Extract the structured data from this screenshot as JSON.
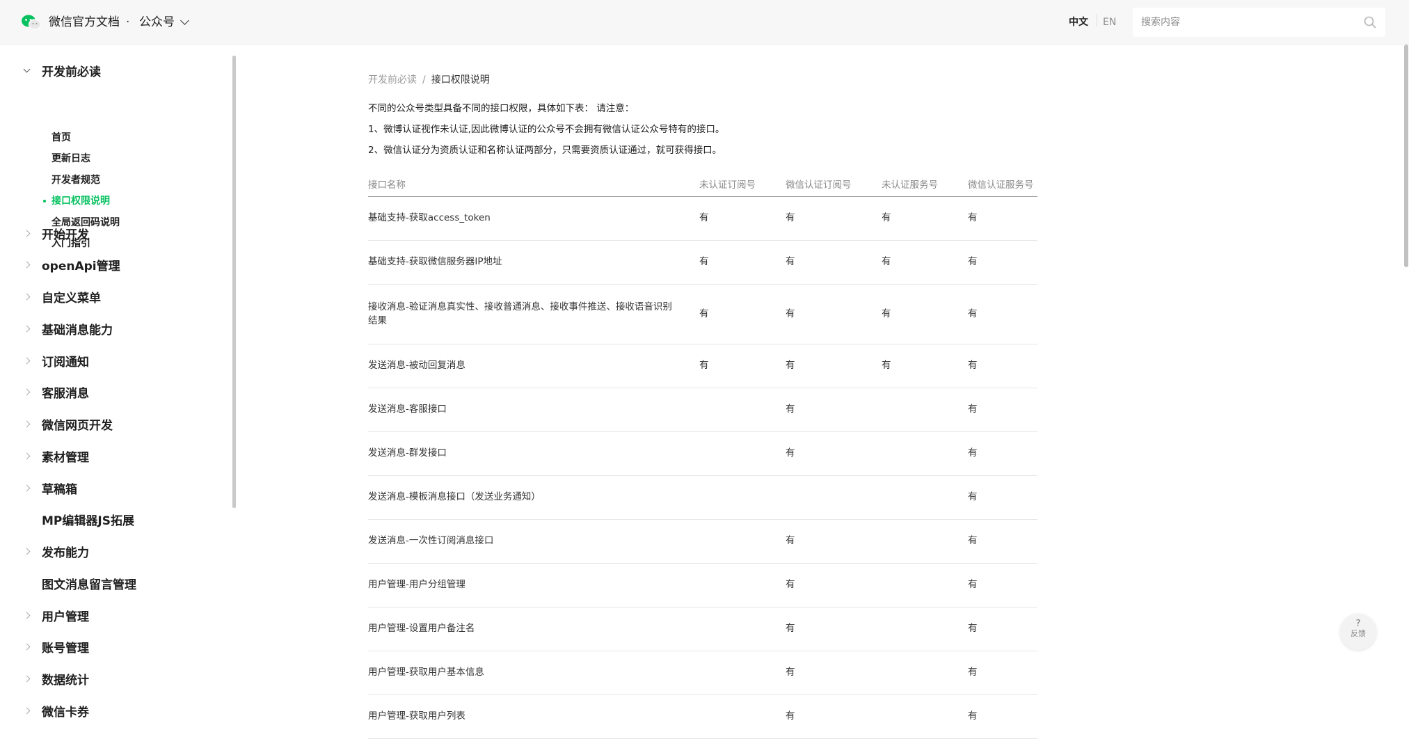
{
  "header": {
    "brand": "微信官方文档",
    "separator": "·",
    "product": "公众号",
    "lang_zh": "中文",
    "lang_en": "EN",
    "search_placeholder": "搜索内容"
  },
  "sidebar": {
    "group_open": "开发前必读",
    "sub_items": [
      {
        "label": "首页",
        "active": false
      },
      {
        "label": "更新日志",
        "active": false
      },
      {
        "label": "开发者规范",
        "active": false
      },
      {
        "label": "接口权限说明",
        "active": true
      },
      {
        "label": "全局返回码说明",
        "active": false
      },
      {
        "label": "入门指引",
        "active": false
      }
    ],
    "sections": [
      {
        "label": "开始开发",
        "arrow": true
      },
      {
        "label": "openApi管理",
        "arrow": true
      },
      {
        "label": "自定义菜单",
        "arrow": true
      },
      {
        "label": "基础消息能力",
        "arrow": true
      },
      {
        "label": "订阅通知",
        "arrow": true
      },
      {
        "label": "客服消息",
        "arrow": true
      },
      {
        "label": "微信网页开发",
        "arrow": true
      },
      {
        "label": "素材管理",
        "arrow": true
      },
      {
        "label": "草稿箱",
        "arrow": true
      },
      {
        "label": "MP编辑器JS拓展",
        "arrow": false
      },
      {
        "label": "发布能力",
        "arrow": true
      },
      {
        "label": "图文消息留言管理",
        "arrow": false
      },
      {
        "label": "用户管理",
        "arrow": true
      },
      {
        "label": "账号管理",
        "arrow": true
      },
      {
        "label": "数据统计",
        "arrow": true
      },
      {
        "label": "微信卡券",
        "arrow": true
      }
    ]
  },
  "breadcrumb": {
    "parent": "开发前必读",
    "separator": "/",
    "current": "接口权限说明"
  },
  "intro": [
    "不同的公众号类型具备不同的接口权限，具体如下表： 请注意：",
    "1、微博认证视作未认证,因此微博认证的公众号不会拥有微信认证公众号特有的接口。",
    "2、微信认证分为资质认证和名称认证两部分，只需要资质认证通过，就可获得接口。"
  ],
  "table": {
    "headers": [
      "接口名称",
      "未认证订阅号",
      "微信认证订阅号",
      "未认证服务号",
      "微信认证服务号"
    ],
    "rows": [
      {
        "name": "基础支持-获取access_token",
        "cells": [
          "有",
          "有",
          "有",
          "有"
        ]
      },
      {
        "name": "基础支持-获取微信服务器IP地址",
        "cells": [
          "有",
          "有",
          "有",
          "有"
        ]
      },
      {
        "name": "接收消息-验证消息真实性、接收普通消息、接收事件推送、接收语音识别结果",
        "cells": [
          "有",
          "有",
          "有",
          "有"
        ]
      },
      {
        "name": "发送消息-被动回复消息",
        "cells": [
          "有",
          "有",
          "有",
          "有"
        ]
      },
      {
        "name": "发送消息-客服接口",
        "cells": [
          "",
          "有",
          "",
          "有"
        ]
      },
      {
        "name": "发送消息-群发接口",
        "cells": [
          "",
          "有",
          "",
          "有"
        ]
      },
      {
        "name": "发送消息-模板消息接口（发送业务通知）",
        "cells": [
          "",
          "",
          "",
          "有"
        ]
      },
      {
        "name": "发送消息-一次性订阅消息接口",
        "cells": [
          "",
          "有",
          "",
          "有"
        ]
      },
      {
        "name": "用户管理-用户分组管理",
        "cells": [
          "",
          "有",
          "",
          "有"
        ]
      },
      {
        "name": "用户管理-设置用户备注名",
        "cells": [
          "",
          "有",
          "",
          "有"
        ]
      },
      {
        "name": "用户管理-获取用户基本信息",
        "cells": [
          "",
          "有",
          "",
          "有"
        ]
      },
      {
        "name": "用户管理-获取用户列表",
        "cells": [
          "",
          "有",
          "",
          "有"
        ]
      }
    ]
  },
  "feedback": {
    "icon": "?",
    "label": "反馈"
  },
  "colors": {
    "accent": "#07c160",
    "header_bg": "#f7f7f7"
  }
}
